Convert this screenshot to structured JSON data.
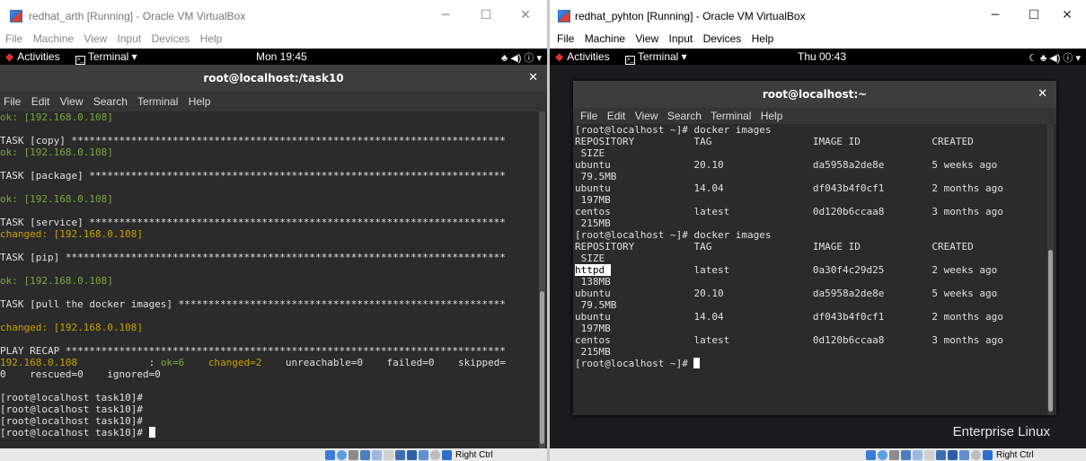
{
  "left_window": {
    "title": "redhat_arth [Running] - Oracle VM VirtualBox",
    "menu": [
      "File",
      "Machine",
      "View",
      "Input",
      "Devices",
      "Help"
    ],
    "gnome": {
      "activities": "Activities",
      "terminal": "Terminal ▾",
      "clock": "Mon 19:45",
      "tray": "♣ ◀) ⓘ ▾"
    },
    "terminal_title": "root@localhost:/task10",
    "terminal_menu": [
      "File",
      "Edit",
      "View",
      "Search",
      "Terminal",
      "Help"
    ],
    "lines": [
      {
        "parts": [
          {
            "t": "ok: [192.168.0.108]",
            "c": "green"
          }
        ]
      },
      {
        "parts": [
          {
            "t": ""
          }
        ]
      },
      {
        "parts": [
          {
            "t": "TASK [copy] *************************************************************************"
          }
        ]
      },
      {
        "parts": [
          {
            "t": "ok: [192.168.0.108]",
            "c": "green"
          }
        ]
      },
      {
        "parts": [
          {
            "t": ""
          }
        ]
      },
      {
        "parts": [
          {
            "t": "TASK [package] **********************************************************************"
          }
        ]
      },
      {
        "parts": [
          {
            "t": ""
          }
        ]
      },
      {
        "parts": [
          {
            "t": "ok: [192.168.0.108]",
            "c": "green"
          }
        ]
      },
      {
        "parts": [
          {
            "t": ""
          }
        ]
      },
      {
        "parts": [
          {
            "t": "TASK [service] **********************************************************************"
          }
        ]
      },
      {
        "parts": [
          {
            "t": "changed: [192.168.0.108]",
            "c": "orange"
          }
        ]
      },
      {
        "parts": [
          {
            "t": ""
          }
        ]
      },
      {
        "parts": [
          {
            "t": "TASK [pip] **************************************************************************"
          }
        ]
      },
      {
        "parts": [
          {
            "t": ""
          }
        ]
      },
      {
        "parts": [
          {
            "t": "ok: [192.168.0.108]",
            "c": "green"
          }
        ]
      },
      {
        "parts": [
          {
            "t": ""
          }
        ]
      },
      {
        "parts": [
          {
            "t": "TASK [pull the docker images] *******************************************************"
          }
        ]
      },
      {
        "parts": [
          {
            "t": ""
          }
        ]
      },
      {
        "parts": [
          {
            "t": "changed: [192.168.0.108]",
            "c": "orange"
          }
        ]
      },
      {
        "parts": [
          {
            "t": ""
          }
        ]
      },
      {
        "parts": [
          {
            "t": "PLAY RECAP **************************************************************************"
          }
        ]
      },
      {
        "parts": [
          {
            "t": "192.168.0.108",
            "c": "orange"
          },
          {
            "t": "            : "
          },
          {
            "t": "ok=6",
            "c": "green"
          },
          {
            "t": "    "
          },
          {
            "t": "changed=2",
            "c": "orange"
          },
          {
            "t": "    unreachable=0    failed=0    skipped="
          }
        ]
      },
      {
        "parts": [
          {
            "t": "0    rescued=0    ignored=0"
          }
        ]
      },
      {
        "parts": [
          {
            "t": ""
          }
        ]
      },
      {
        "parts": [
          {
            "t": "[root@localhost task10]#"
          }
        ]
      },
      {
        "parts": [
          {
            "t": "[root@localhost task10]#"
          }
        ]
      },
      {
        "parts": [
          {
            "t": "[root@localhost task10]#"
          }
        ]
      },
      {
        "parts": [
          {
            "t": "[root@localhost task10]# "
          }
        ],
        "cursor": true
      }
    ],
    "status": "Right Ctrl"
  },
  "right_window": {
    "title": "redhat_pyhton [Running] - Oracle VM VirtualBox",
    "menu": [
      "File",
      "Machine",
      "View",
      "Input",
      "Devices",
      "Help"
    ],
    "gnome": {
      "activities": "Activities",
      "terminal": "Terminal ▾",
      "clock": "Thu 00:43",
      "tray": "☾ ♣ ◀) ⓘ ▾"
    },
    "terminal_title": "root@localhost:~",
    "terminal_menu": [
      "File",
      "Edit",
      "View",
      "Search",
      "Terminal",
      "Help"
    ],
    "lines": [
      {
        "parts": [
          {
            "t": "[root@localhost ~]# docker images"
          }
        ]
      },
      {
        "parts": [
          {
            "t": "REPOSITORY          TAG                 IMAGE ID            CREATED"
          }
        ]
      },
      {
        "parts": [
          {
            "t": " SIZE"
          }
        ]
      },
      {
        "parts": [
          {
            "t": "ubuntu              20.10               da5958a2de8e        5 weeks ago"
          }
        ]
      },
      {
        "parts": [
          {
            "t": " 79.5MB"
          }
        ]
      },
      {
        "parts": [
          {
            "t": "ubuntu              14.04               df043b4f0cf1        2 months ago"
          }
        ]
      },
      {
        "parts": [
          {
            "t": " 197MB"
          }
        ]
      },
      {
        "parts": [
          {
            "t": "centos              latest              0d120b6ccaa8        3 months ago"
          }
        ]
      },
      {
        "parts": [
          {
            "t": " 215MB"
          }
        ]
      },
      {
        "parts": [
          {
            "t": "[root@localhost ~]# docker images"
          }
        ]
      },
      {
        "parts": [
          {
            "t": "REPOSITORY          TAG                 IMAGE ID            CREATED"
          }
        ]
      },
      {
        "parts": [
          {
            "t": " SIZE"
          }
        ]
      },
      {
        "parts": [
          {
            "t": "httpd ",
            "c": "sel"
          },
          {
            "t": "              latest              0a30f4c29d25        2 weeks ago"
          }
        ]
      },
      {
        "parts": [
          {
            "t": " 138MB"
          }
        ]
      },
      {
        "parts": [
          {
            "t": "ubuntu              20.10               da5958a2de8e        5 weeks ago"
          }
        ]
      },
      {
        "parts": [
          {
            "t": " 79.5MB"
          }
        ]
      },
      {
        "parts": [
          {
            "t": "ubuntu              14.04               df043b4f0cf1        2 months ago"
          }
        ]
      },
      {
        "parts": [
          {
            "t": " 197MB"
          }
        ]
      },
      {
        "parts": [
          {
            "t": "centos              latest              0d120b6ccaa8        3 months ago"
          }
        ]
      },
      {
        "parts": [
          {
            "t": " 215MB"
          }
        ]
      },
      {
        "parts": [
          {
            "t": "[root@localhost ~]# "
          }
        ],
        "cursor": true
      }
    ],
    "desktop_text": "Enterprise Linux",
    "status": "Right Ctrl"
  }
}
